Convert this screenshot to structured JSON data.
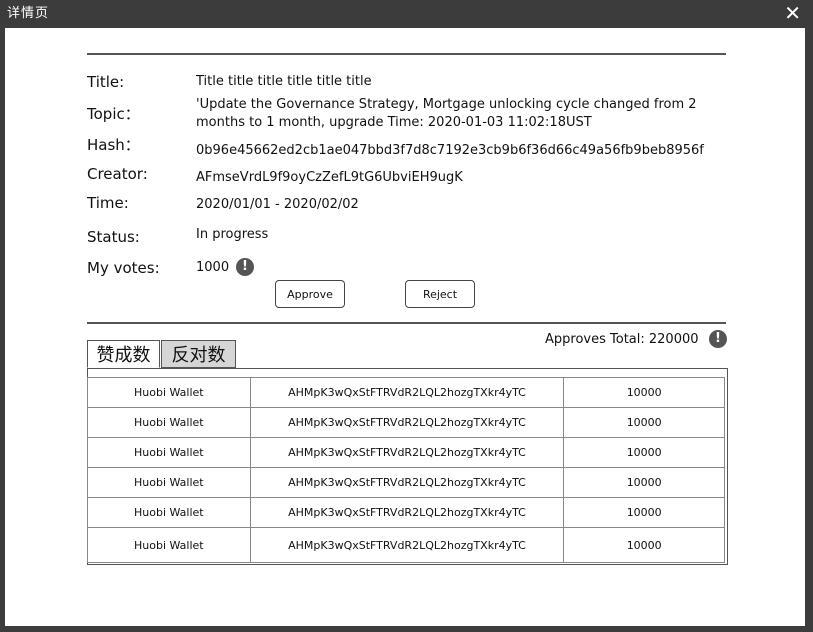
{
  "window": {
    "title": "详情页",
    "close_glyph": "✕"
  },
  "details": {
    "title_label": "Title:",
    "title_value": "Title title title title title title",
    "topic_label": "Topic：",
    "topic_line1": "'Update the Governance Strategy, Mortgage unlocking cycle changed from 2",
    "topic_line2": "months to 1 month, upgrade Time: 2020-01-03 11:02:18UST",
    "hash_label": "Hash：",
    "hash_value": "0b96e45662ed2cb1ae047bbd3f7d8c7192e3cb9b6f36d66c49a56fb9beb8956f",
    "creator_label": "Creator:",
    "creator_value": "AFmseVrdL9f9oyCzZefL9tG6UbviEH9ugK",
    "time_label": "Time:",
    "time_value": "2020/01/01 - 2020/02/02",
    "status_label": "Status:",
    "status_value": "In progress",
    "votes_label": "My votes:",
    "votes_value": "1000",
    "info_glyph": "!"
  },
  "actions": {
    "approve_label": "Approve",
    "reject_label": "Reject"
  },
  "tabs": [
    {
      "label": "赞成数",
      "active": true
    },
    {
      "label": "反对数",
      "active": false
    }
  ],
  "approves_total": "Approves Total: 220000",
  "rows": [
    {
      "name": "Huobi Wallet",
      "address": "AHMpK3wQxStFTRVdR2LQL2hozgTXkr4yTC",
      "amount": "10000"
    },
    {
      "name": "Huobi Wallet",
      "address": "AHMpK3wQxStFTRVdR2LQL2hozgTXkr4yTC",
      "amount": "10000"
    },
    {
      "name": "Huobi Wallet",
      "address": "AHMpK3wQxStFTRVdR2LQL2hozgTXkr4yTC",
      "amount": "10000"
    },
    {
      "name": "Huobi Wallet",
      "address": "AHMpK3wQxStFTRVdR2LQL2hozgTXkr4yTC",
      "amount": "10000"
    },
    {
      "name": "Huobi Wallet",
      "address": "AHMpK3wQxStFTRVdR2LQL2hozgTXkr4yTC",
      "amount": "10000"
    },
    {
      "name": "Huobi Wallet",
      "address": "AHMpK3wQxStFTRVdR2LQL2hozgTXkr4yTC",
      "amount": "10000"
    }
  ]
}
